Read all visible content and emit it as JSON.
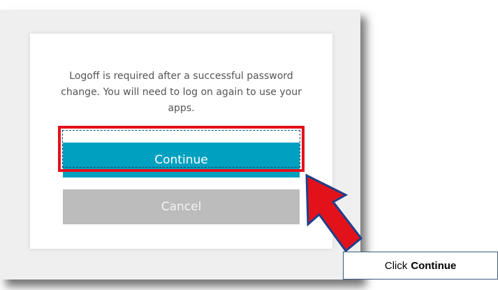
{
  "dialog": {
    "message": "Logoff is required after a successful password change. You will need to log on again to use your apps.",
    "continue_label": "Continue",
    "cancel_label": "Cancel"
  },
  "callout": {
    "prefix": "Click",
    "target": "Continue"
  },
  "colors": {
    "continue_button": "#00a0c0",
    "cancel_button": "#bcbcbc",
    "highlight": "#e2121b",
    "arrow_fill": "#e2121b",
    "arrow_outline": "#1f3f8a"
  },
  "icons": {
    "pointer_arrow": "red-arrow-icon"
  }
}
